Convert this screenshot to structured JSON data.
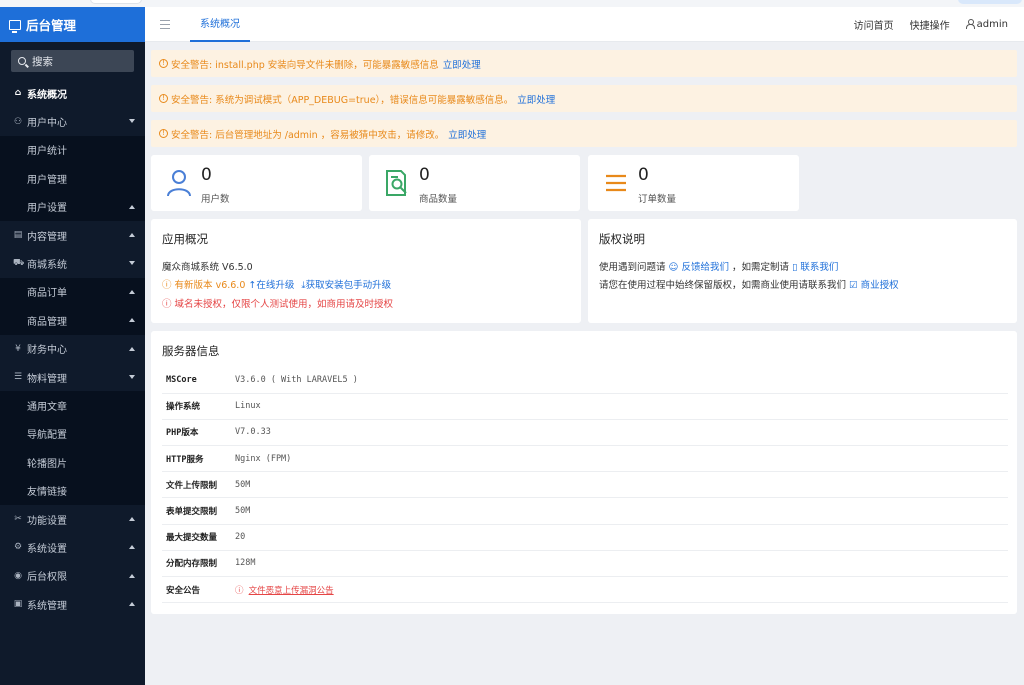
{
  "sidebar": {
    "brand": "后台管理",
    "search_label": "搜索",
    "items": [
      {
        "label": "系统概况",
        "icon": "home-icon",
        "glyph": "⌂",
        "active": true
      },
      {
        "label": "用户中心",
        "icon": "users-icon",
        "glyph": "⚇",
        "caret": "down"
      },
      {
        "label": "用户统计",
        "sub": true
      },
      {
        "label": "用户管理",
        "sub": true
      },
      {
        "label": "用户设置",
        "sub": true,
        "caret": "up"
      },
      {
        "label": "内容管理",
        "icon": "document-icon",
        "glyph": "▤",
        "caret": "up"
      },
      {
        "label": "商城系统",
        "icon": "cart-icon",
        "glyph": "⛟",
        "caret": "down"
      },
      {
        "label": "商品订单",
        "sub": true,
        "caret": "up"
      },
      {
        "label": "商品管理",
        "sub": true,
        "caret": "up"
      },
      {
        "label": "财务中心",
        "icon": "yen-icon",
        "glyph": "¥",
        "caret": "up"
      },
      {
        "label": "物料管理",
        "icon": "list-icon",
        "glyph": "☰",
        "caret": "down"
      },
      {
        "label": "通用文章",
        "sub": true
      },
      {
        "label": "导航配置",
        "sub": true
      },
      {
        "label": "轮播图片",
        "sub": true
      },
      {
        "label": "友情链接",
        "sub": true
      },
      {
        "label": "功能设置",
        "icon": "tools-icon",
        "glyph": "✂",
        "caret": "up"
      },
      {
        "label": "系统设置",
        "icon": "gear-icon",
        "glyph": "⚙",
        "caret": "up"
      },
      {
        "label": "后台权限",
        "icon": "user-circle-icon",
        "glyph": "◉",
        "caret": "up"
      },
      {
        "label": "系统管理",
        "icon": "window-icon",
        "glyph": "▣",
        "caret": "up"
      }
    ]
  },
  "header": {
    "tab": "系统概况",
    "visit_home": "访问首页",
    "quick_ops": "快捷操作",
    "user": "admin"
  },
  "warnings": [
    {
      "text": "安全警告: install.php 安装向导文件未删除，可能暴露敏感信息",
      "link": "立即处理"
    },
    {
      "text": "安全警告: 系统为调试模式（APP_DEBUG=true），错误信息可能暴露敏感信息。",
      "link": "立即处理"
    },
    {
      "text": "安全警告: 后台管理地址为 /admin ，容易被猜中攻击，请修改。",
      "link": "立即处理"
    }
  ],
  "stats": [
    {
      "value": "0",
      "label": "用户数",
      "icon": "user-icon",
      "color": "#4a7fd6"
    },
    {
      "value": "0",
      "label": "商品数量",
      "icon": "search-doc-icon",
      "color": "#3aa766"
    },
    {
      "value": "0",
      "label": "订单数量",
      "icon": "list-icon",
      "color": "#e8891a"
    }
  ],
  "app": {
    "title": "应用概况",
    "system": "魔众商城系统 V6.5.0",
    "new_version": "有新版本 v6.6.0",
    "online_upgrade": "在线升级",
    "manual_upgrade": "获取安装包手动升级",
    "license_warning": "域名未授权，仅限个人测试使用，如商用请及时授权"
  },
  "copyright": {
    "title": "版权说明",
    "line1_pre": "使用遇到问题请",
    "feedback": "反馈给我们",
    "line1_mid": "，如需定制请",
    "contact": "联系我们",
    "line2_pre": "请您在使用过程中始终保留版权，如需商业使用请联系我们",
    "commercial": "商业授权"
  },
  "server": {
    "title": "服务器信息",
    "rows": [
      {
        "key": "MSCore",
        "value": "V3.6.0 ( With LARAVEL5 )"
      },
      {
        "key": "操作系统",
        "value": "Linux"
      },
      {
        "key": "PHP版本",
        "value": "V7.0.33"
      },
      {
        "key": "HTTP服务",
        "value": "Nginx (FPM)"
      },
      {
        "key": "文件上传限制",
        "value": "50M"
      },
      {
        "key": "表单提交限制",
        "value": "50M"
      },
      {
        "key": "最大提交数量",
        "value": "20"
      },
      {
        "key": "分配内存限制",
        "value": "128M"
      },
      {
        "key": "安全公告",
        "value": "文件恶意上传漏洞公告"
      }
    ]
  }
}
